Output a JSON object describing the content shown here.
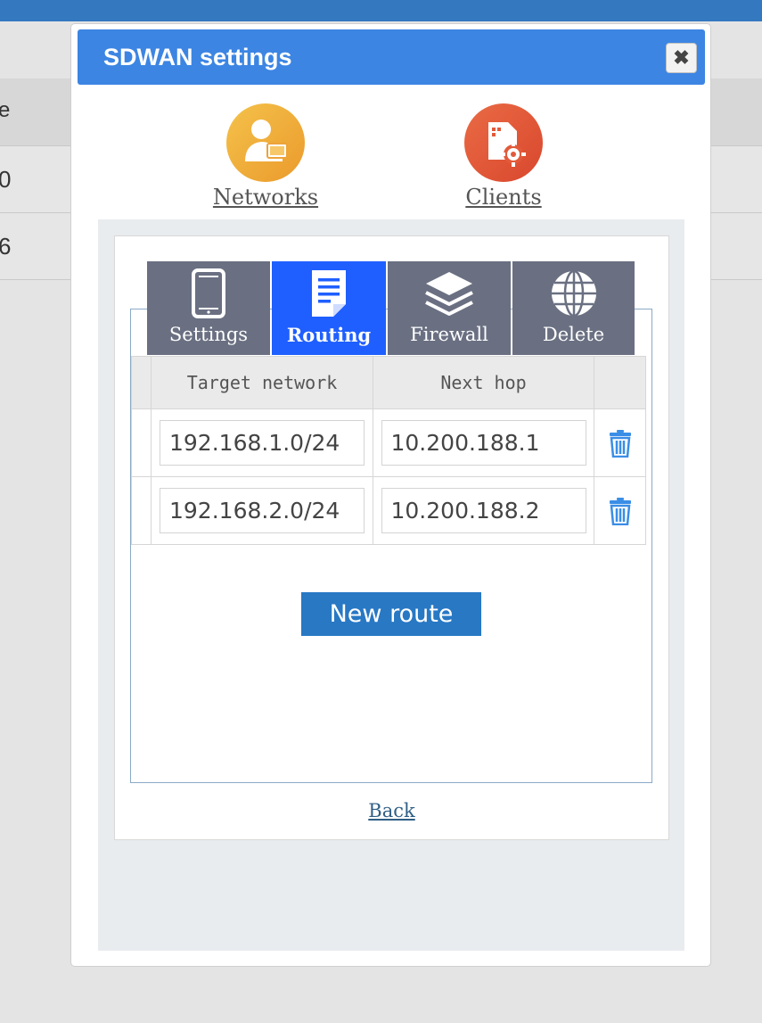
{
  "background": {
    "header_fragment": "e",
    "rows": [
      "0",
      "6"
    ]
  },
  "modal": {
    "title": "SDWAN settings",
    "close_label": "✖"
  },
  "nav": {
    "networks_label": "Networks",
    "clients_label": "Clients"
  },
  "tabs": {
    "settings_label": "Settings",
    "routing_label": "Routing",
    "firewall_label": "Firewall",
    "delete_label": "Delete",
    "active": "Routing"
  },
  "routes_table": {
    "headers": [
      "Target network",
      "Next hop"
    ],
    "rows": [
      {
        "target": "192.168.1.0/24",
        "next_hop": "10.200.188.1"
      },
      {
        "target": "192.168.2.0/24",
        "next_hop": "10.200.188.2"
      }
    ]
  },
  "actions": {
    "new_route_label": "New route",
    "back_label": "Back"
  },
  "colors": {
    "header_blue": "#3c85e3",
    "active_tab": "#1f5fff",
    "inactive_tab": "#6a7082",
    "button_blue": "#2878c4",
    "trash_blue": "#3a8ee6"
  }
}
